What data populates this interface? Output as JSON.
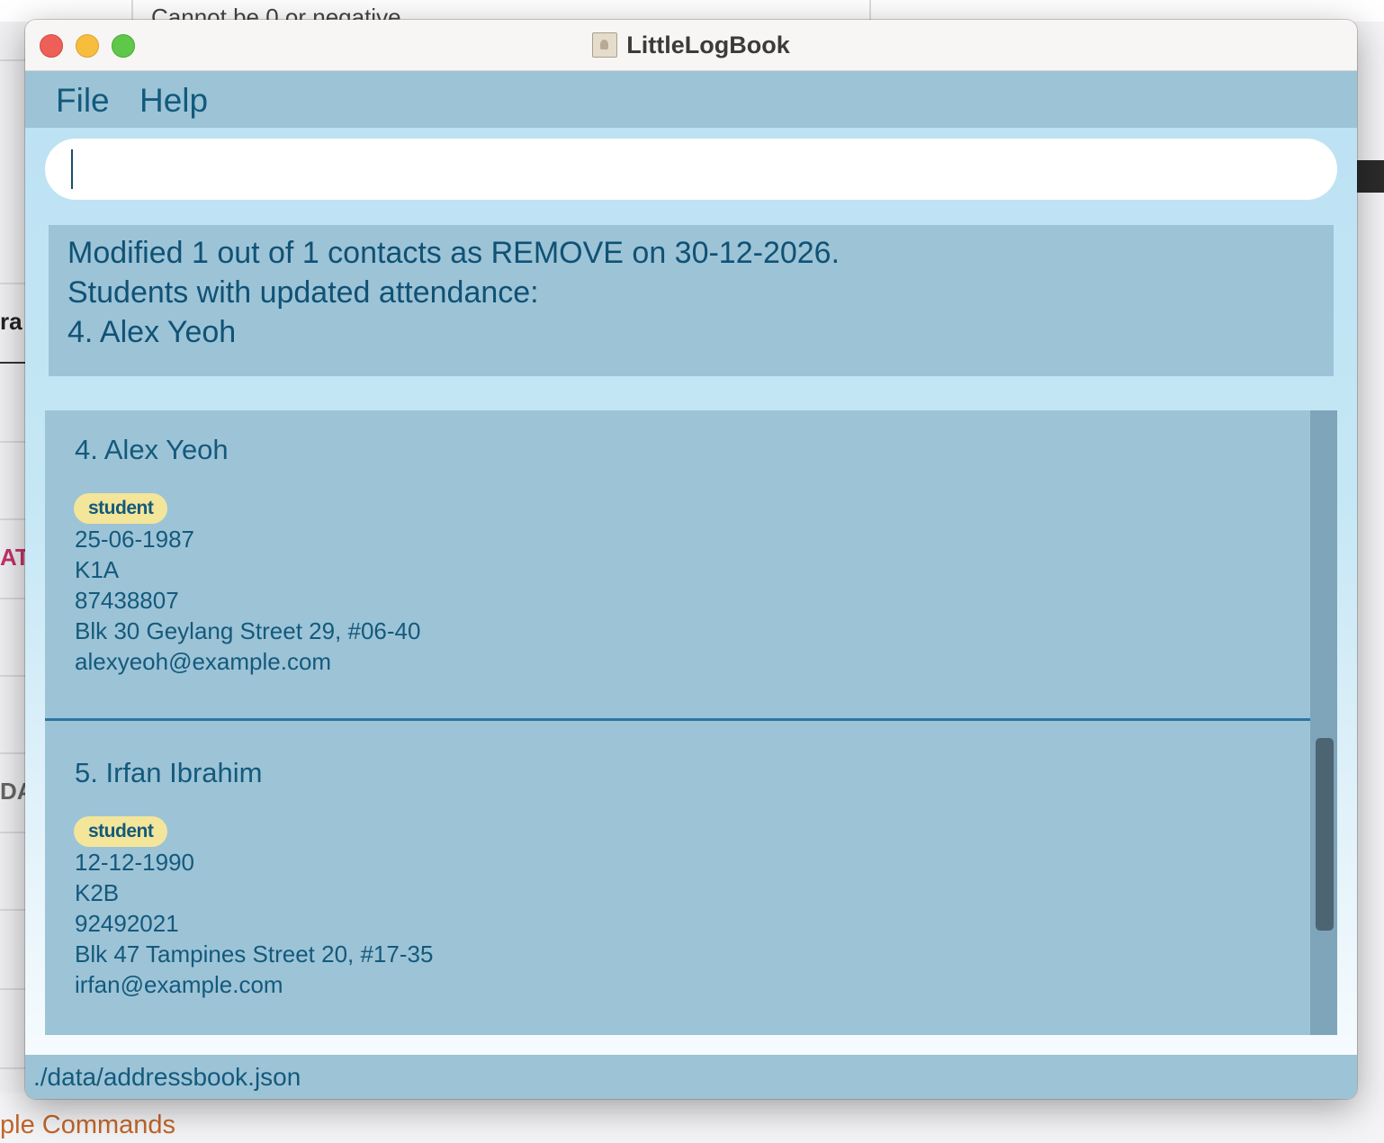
{
  "background": {
    "top_text": "Cannot be 0 or negative",
    "left_snippets": [
      "ra",
      "AT",
      "DA"
    ],
    "bottom_text": "ple Commands"
  },
  "window": {
    "title": "LittleLogBook",
    "icon": "address-book-icon"
  },
  "menu": {
    "file": "File",
    "help": "Help"
  },
  "command": {
    "value": "",
    "placeholder": ""
  },
  "result": {
    "lines": [
      "Modified 1 out of 1 contacts as REMOVE on 30-12-2026.",
      "Students with updated attendance:",
      "4. Alex Yeoh"
    ]
  },
  "contacts": [
    {
      "name": "4. Alex Yeoh",
      "tag": "student",
      "birthday": "25-06-1987",
      "class": "K1A",
      "phone": "87438807",
      "address": "Blk 30 Geylang Street 29, #06-40",
      "email": "alexyeoh@example.com"
    },
    {
      "name": "5. Irfan Ibrahim",
      "tag": "student",
      "birthday": "12-12-1990",
      "class": "K2B",
      "phone": "92492021",
      "address": "Blk 47 Tampines Street 20, #17-35",
      "email": "irfan@example.com"
    }
  ],
  "status": {
    "file_path": "./data/addressbook.json"
  },
  "colors": {
    "panel": "#9dc3d7",
    "text": "#135a7c",
    "tag": "#f3e59a",
    "separator": "#2b76a0"
  }
}
